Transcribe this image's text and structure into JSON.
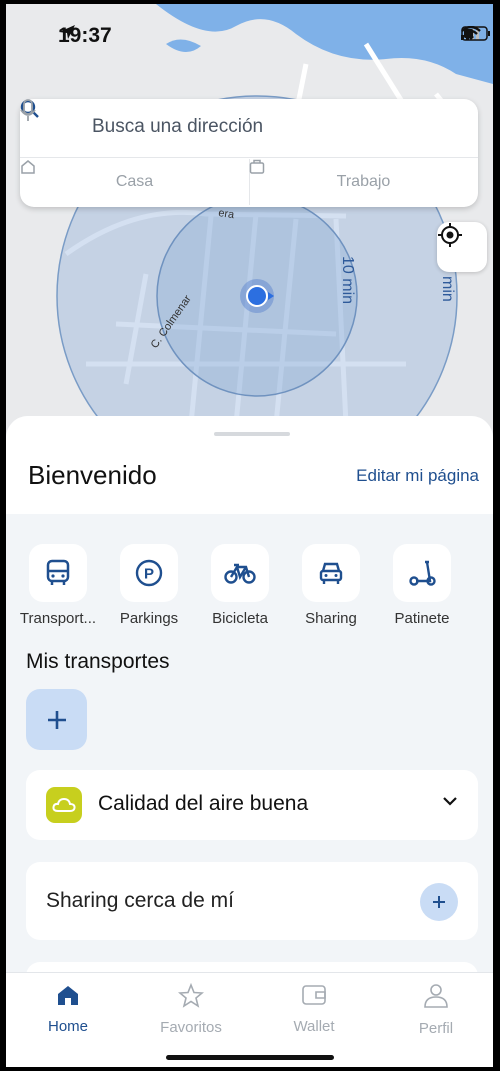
{
  "status_bar": {
    "time": "19:37"
  },
  "search": {
    "placeholder": "Busca una dirección",
    "home_label": "Casa",
    "work_label": "Trabajo"
  },
  "map": {
    "street_label_1": "C. Colmenar",
    "street_label_2": "era",
    "radius_label_1": "10 min",
    "radius_label_2": "min"
  },
  "sheet": {
    "title": "Bienvenido",
    "edit_link": "Editar mi página",
    "categories": [
      {
        "label": "Transport...",
        "icon": "bus-icon"
      },
      {
        "label": "Parkings",
        "icon": "parking-icon"
      },
      {
        "label": "Bicicleta",
        "icon": "bicycle-icon"
      },
      {
        "label": "Sharing",
        "icon": "car-icon"
      },
      {
        "label": "Patinete",
        "icon": "scooter-icon"
      }
    ],
    "my_transports_title": "Mis transportes",
    "air_quality": "Calidad del aire buena",
    "sharing_nearby": "Sharing cerca de mí"
  },
  "tabbar": {
    "tabs": [
      {
        "label": "Home",
        "icon": "home-icon",
        "active": true
      },
      {
        "label": "Favoritos",
        "icon": "star-icon",
        "active": false
      },
      {
        "label": "Wallet",
        "icon": "wallet-icon",
        "active": false
      },
      {
        "label": "Perfil",
        "icon": "profile-icon",
        "active": false
      }
    ]
  },
  "colors": {
    "accent": "#1f4f8f",
    "light_accent": "#c9dcf5",
    "air_badge": "#c7cf1e",
    "map_water": "#7fb1e8"
  }
}
